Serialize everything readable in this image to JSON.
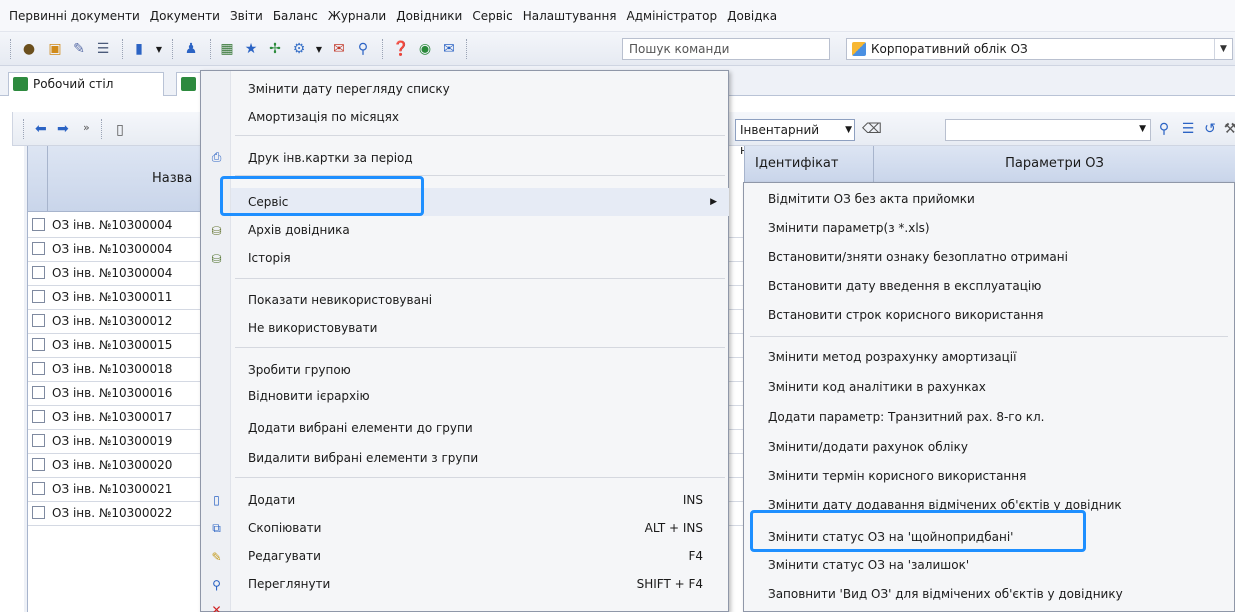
{
  "menubar": {
    "items": [
      "Первинні документи",
      "Документи",
      "Звіти",
      "Баланс",
      "Журнали",
      "Довідники",
      "Сервіс",
      "Налаштування",
      "Адміністратор",
      "Довідка"
    ]
  },
  "toolbar": {
    "search_placeholder": "Пошук команди",
    "profile": "Корпоративний облік ОЗ"
  },
  "tabs": [
    "Робочий стіл"
  ],
  "innerbar": {
    "search_field": "Інвентарний номер"
  },
  "grid": {
    "header_name": "Назва",
    "col_identifier": "Ідентифікат",
    "col_params": "Параметри ОЗ",
    "rows": [
      "ОЗ інв. №10300004",
      "ОЗ інв. №10300004",
      "ОЗ інв. №10300004",
      "ОЗ інв. №10300011",
      "ОЗ інв. №10300012",
      "ОЗ інв. №10300015",
      "ОЗ інв. №10300018",
      "ОЗ інв. №10300016",
      "ОЗ інв. №10300017",
      "ОЗ інв. №10300019",
      "ОЗ інв. №10300020",
      "ОЗ інв. №10300021",
      "ОЗ інв. №10300022"
    ]
  },
  "context_menu": {
    "items": [
      {
        "label": "Змінити дату перегляду списку"
      },
      {
        "label": "Амортизація по місяцях"
      },
      {
        "label": "Друк інв.картки за період"
      },
      {
        "label": "Сервіс"
      },
      {
        "label": "Архів довідника"
      },
      {
        "label": "Історія"
      },
      {
        "label": "Показати невикористовувані"
      },
      {
        "label": "Не використовувати"
      },
      {
        "label": "Зробити групою"
      },
      {
        "label": "Відновити ієрархію"
      },
      {
        "label": "Додати вибрані елементи до групи"
      },
      {
        "label": "Видалити вибрані елементи з групи"
      },
      {
        "label": "Додати",
        "shortcut": "INS"
      },
      {
        "label": "Скопіювати",
        "shortcut": "ALT + INS"
      },
      {
        "label": "Редагувати",
        "shortcut": "F4"
      },
      {
        "label": "Переглянути",
        "shortcut": "SHIFT + F4"
      }
    ]
  },
  "submenu": {
    "items": [
      "Відмітити ОЗ без акта прийомки",
      "Змінити параметр(з *.xls)",
      "Встановити/зняти ознаку безоплатно отримані",
      "Встановити дату введення в експлуатацію",
      "Встановити строк корисного використання",
      "Змінити метод розрахунку амортизації",
      "Змінити код аналітики в рахунках",
      "Додати параметр: Транзитний рах. 8-го кл.",
      "Змінити/додати рахунок обліку",
      "Змінити термін корисного використання",
      "Змінити дату додавання відмічених об'єктів у довідник",
      "Змінити статус ОЗ на 'щойнопридбані'",
      "Змінити статус ОЗ на 'залишок'",
      "Заповнити 'Вид ОЗ' для відмічених об'єктів у довіднику"
    ]
  },
  "colors": {
    "highlight": "#1e8fff"
  }
}
